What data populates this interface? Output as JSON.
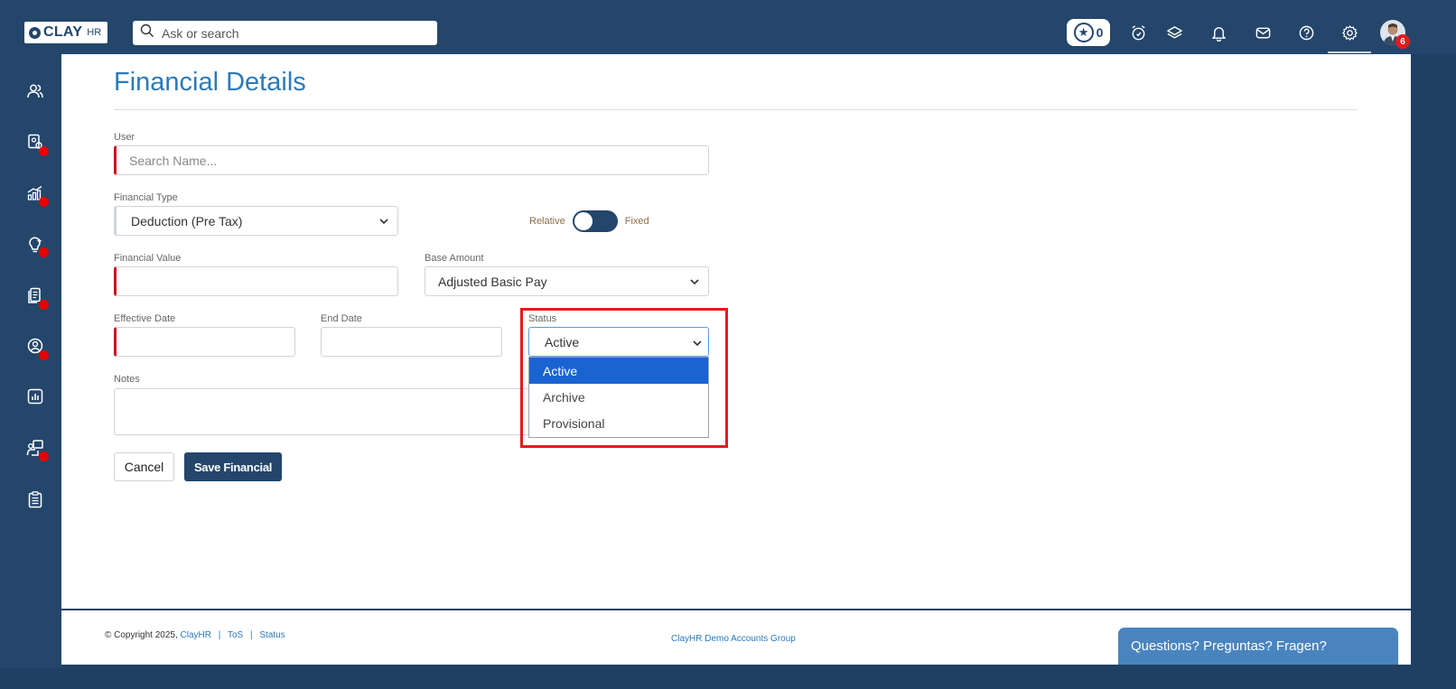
{
  "header": {
    "logo_text": "CLAY",
    "logo_sub": "HR",
    "search_placeholder": "Ask or search",
    "points_count": "0",
    "avatar_badge": "6"
  },
  "page": {
    "title": "Financial Details"
  },
  "form": {
    "user": {
      "label": "User",
      "placeholder": "Search Name..."
    },
    "financial_type": {
      "label": "Financial Type",
      "value": "Deduction (Pre Tax)"
    },
    "toggle": {
      "left_label": "Relative",
      "right_label": "Fixed"
    },
    "financial_value": {
      "label": "Financial Value"
    },
    "base_amount": {
      "label": "Base Amount",
      "value": "Adjusted Basic Pay"
    },
    "effective_date": {
      "label": "Effective Date"
    },
    "end_date": {
      "label": "End Date"
    },
    "status": {
      "label": "Status",
      "value": "Active",
      "options": [
        "Active",
        "Archive",
        "Provisional"
      ]
    },
    "notes": {
      "label": "Notes"
    },
    "cancel_label": "Cancel",
    "save_label": "Save Financial"
  },
  "footer": {
    "copyright": "© Copyright 2025,",
    "brand_link": "ClayHR",
    "tos_link": "ToS",
    "status_link": "Status",
    "group": "ClayHR Demo Accounts Group"
  },
  "chat": {
    "label": "Questions? Preguntas? Fragen?"
  },
  "colors": {
    "navy": "#24466b",
    "title_blue": "#2c7ab8",
    "required_red": "#d0021b",
    "selected_blue": "#1a64d2",
    "highlight_red": "#e21d1d"
  }
}
